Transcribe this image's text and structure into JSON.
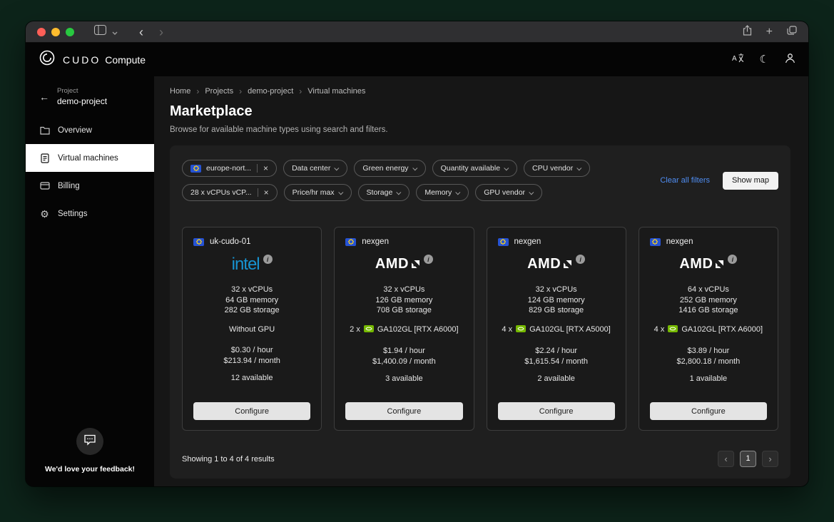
{
  "icons": {
    "close": "×",
    "crumb_sep": "›",
    "back_arrow": "←",
    "info": "i",
    "moon": "☾",
    "gear": "⚙",
    "plus": "+",
    "chevron_left": "‹",
    "chevron_right": "›"
  },
  "header": {
    "brand": "CUDO",
    "product": "Compute"
  },
  "sidebar": {
    "project_label": "Project",
    "project_name": "demo-project",
    "items": [
      {
        "label": "Overview"
      },
      {
        "label": "Virtual machines"
      },
      {
        "label": "Billing"
      },
      {
        "label": "Settings"
      }
    ],
    "feedback_text": "We'd love your feedback!"
  },
  "breadcrumb": {
    "items": [
      "Home",
      "Projects",
      "demo-project",
      "Virtual machines"
    ]
  },
  "page": {
    "title": "Marketplace",
    "subtitle": "Browse for available machine types using search and filters."
  },
  "filters": {
    "row1": [
      {
        "label": "europe-nort..."
      },
      {
        "label": "Data center"
      },
      {
        "label": "Green energy"
      },
      {
        "label": "Quantity available"
      },
      {
        "label": "CPU vendor"
      }
    ],
    "row2": [
      {
        "label": "28 x vCPUs vCP..."
      },
      {
        "label": "Price/hr max"
      },
      {
        "label": "Storage"
      },
      {
        "label": "Memory"
      },
      {
        "label": "GPU vendor"
      }
    ],
    "clear_all": "Clear all filters",
    "show_map": "Show map"
  },
  "machines": [
    {
      "datacenter": "uk-cudo-01",
      "vendor": "intel",
      "vcpus": "32 x vCPUs",
      "memory": "64 GB memory",
      "storage": "282 GB storage",
      "gpu": "Without GPU",
      "price_hour": "$0.30 / hour",
      "price_month": "$213.94 / month",
      "available": "12 available",
      "configure": "Configure"
    },
    {
      "datacenter": "nexgen",
      "vendor": "AMD",
      "vcpus": "32 x vCPUs",
      "memory": "126 GB memory",
      "storage": "708 GB storage",
      "gpu_count": "2 x",
      "gpu_model": "GA102GL [RTX A6000]",
      "price_hour": "$1.94 / hour",
      "price_month": "$1,400.09 / month",
      "available": "3 available",
      "configure": "Configure"
    },
    {
      "datacenter": "nexgen",
      "vendor": "AMD",
      "vcpus": "32 x vCPUs",
      "memory": "124 GB memory",
      "storage": "829 GB storage",
      "gpu_count": "4 x",
      "gpu_model": "GA102GL [RTX A5000]",
      "price_hour": "$2.24 / hour",
      "price_month": "$1,615.54 / month",
      "available": "2 available",
      "configure": "Configure"
    },
    {
      "datacenter": "nexgen",
      "vendor": "AMD",
      "vcpus": "64 x vCPUs",
      "memory": "252 GB memory",
      "storage": "1416 GB storage",
      "gpu_count": "4 x",
      "gpu_model": "GA102GL [RTX A6000]",
      "price_hour": "$3.89 / hour",
      "price_month": "$2,800.18 / month",
      "available": "1 available",
      "configure": "Configure"
    }
  ],
  "results_footer": {
    "summary": "Showing 1 to 4 of 4 results",
    "page": "1"
  }
}
